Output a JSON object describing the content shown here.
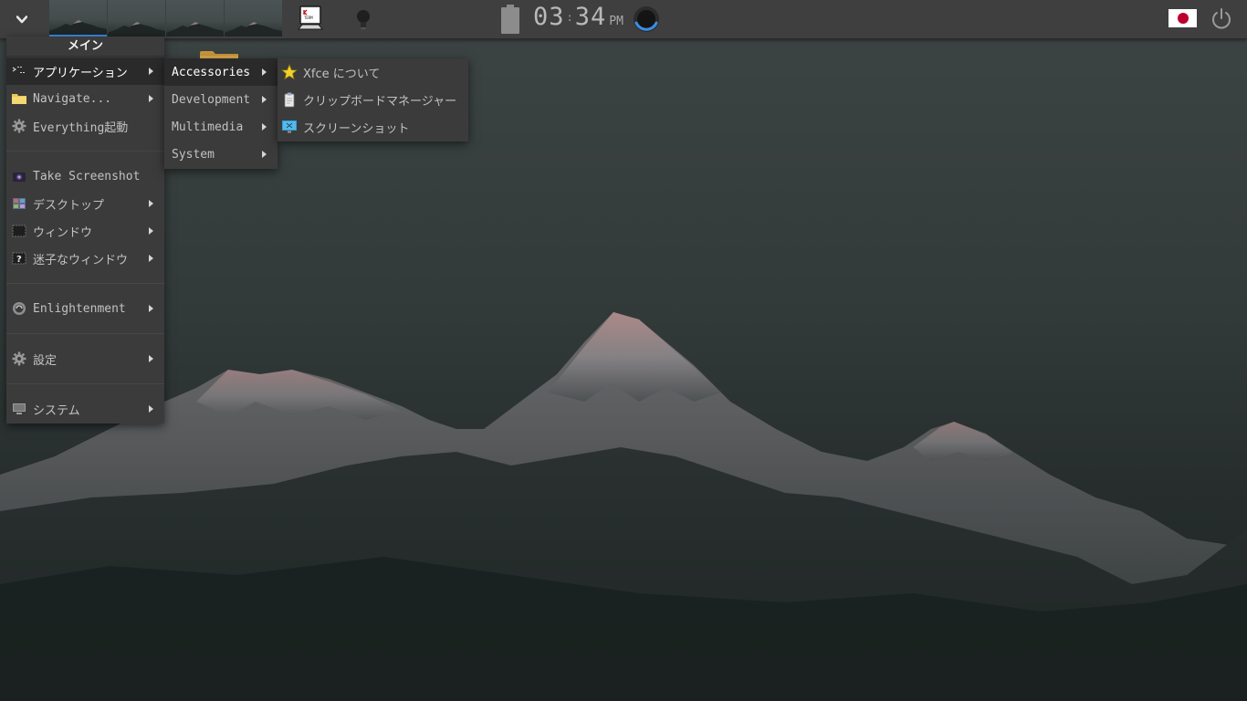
{
  "shelf": {
    "start_icon": "chevron-down-icon",
    "desks": [
      "desk-1",
      "desk-2",
      "desk-3",
      "desk-4"
    ],
    "kterm_icon": "kterm-icon",
    "bulb_icon": "lightbulb-icon",
    "battery_icon": "battery-icon",
    "clock": {
      "hours": "03",
      "separator": ":",
      "minutes": "34",
      "ampm": "PM"
    },
    "busy_icon": "busy-spinner-icon",
    "flag_icon": "japan-flag-icon",
    "power_icon": "power-icon",
    "accent_color": "#3a8ee6"
  },
  "main_menu": {
    "title": "メイン",
    "items": [
      {
        "label": "アプリケーション",
        "icon": "applications-icon",
        "submenu": true
      },
      {
        "label": "Navigate...",
        "icon": "folder-icon",
        "submenu": true
      },
      {
        "label": "Everything起動",
        "icon": "gear-icon",
        "submenu": false
      },
      {
        "label": "Take Screenshot",
        "icon": "camera-icon",
        "submenu": false
      },
      {
        "label": "デスクトップ",
        "icon": "desktop-icon",
        "submenu": true
      },
      {
        "label": "ウィンドウ",
        "icon": "window-icon",
        "submenu": true
      },
      {
        "label": "迷子なウィンドウ",
        "icon": "lost-window-icon",
        "submenu": true
      },
      {
        "label": "Enlightenment",
        "icon": "enlightenment-icon",
        "submenu": true
      },
      {
        "label": "設定",
        "icon": "gear-icon",
        "submenu": true
      },
      {
        "label": "システム",
        "icon": "computer-icon",
        "submenu": true
      }
    ]
  },
  "apps_menu": {
    "items": [
      {
        "label": "Accessories"
      },
      {
        "label": "Development"
      },
      {
        "label": "Multimedia"
      },
      {
        "label": "System"
      }
    ]
  },
  "accessories_menu": {
    "items": [
      {
        "label": "Xfce について",
        "icon": "star-icon"
      },
      {
        "label": "クリップボードマネージャー",
        "icon": "clipboard-icon"
      },
      {
        "label": "スクリーンショット",
        "icon": "screenshot-icon"
      }
    ]
  }
}
